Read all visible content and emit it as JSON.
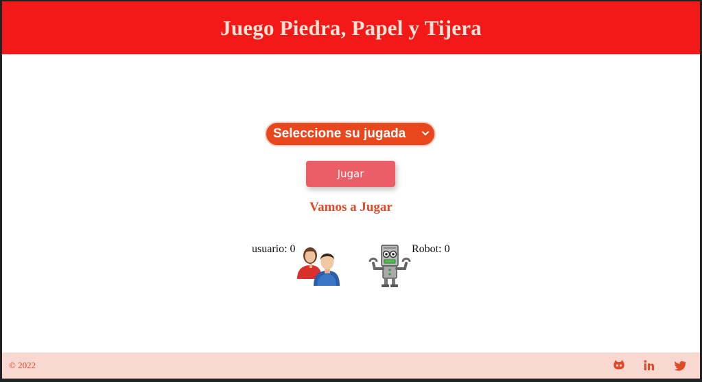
{
  "header": {
    "title": "Juego Piedra, Papel y Tijera"
  },
  "game": {
    "select_value": "Seleccione su jugada",
    "play_button": "Jugar",
    "status": "Vamos a Jugar",
    "user_label": "usuario:",
    "user_score": "0",
    "robot_label": "Robot:",
    "robot_score": "0",
    "user_icon": "users-icon",
    "robot_icon": "robot-icon"
  },
  "footer": {
    "copyright": "© 2022",
    "social": [
      "github-icon",
      "linkedin-icon",
      "twitter-icon"
    ]
  },
  "colors": {
    "header_bg": "#f31919",
    "accent": "#e8461c",
    "button": "#ec5e67",
    "footer_bg": "#f9d8d1"
  }
}
